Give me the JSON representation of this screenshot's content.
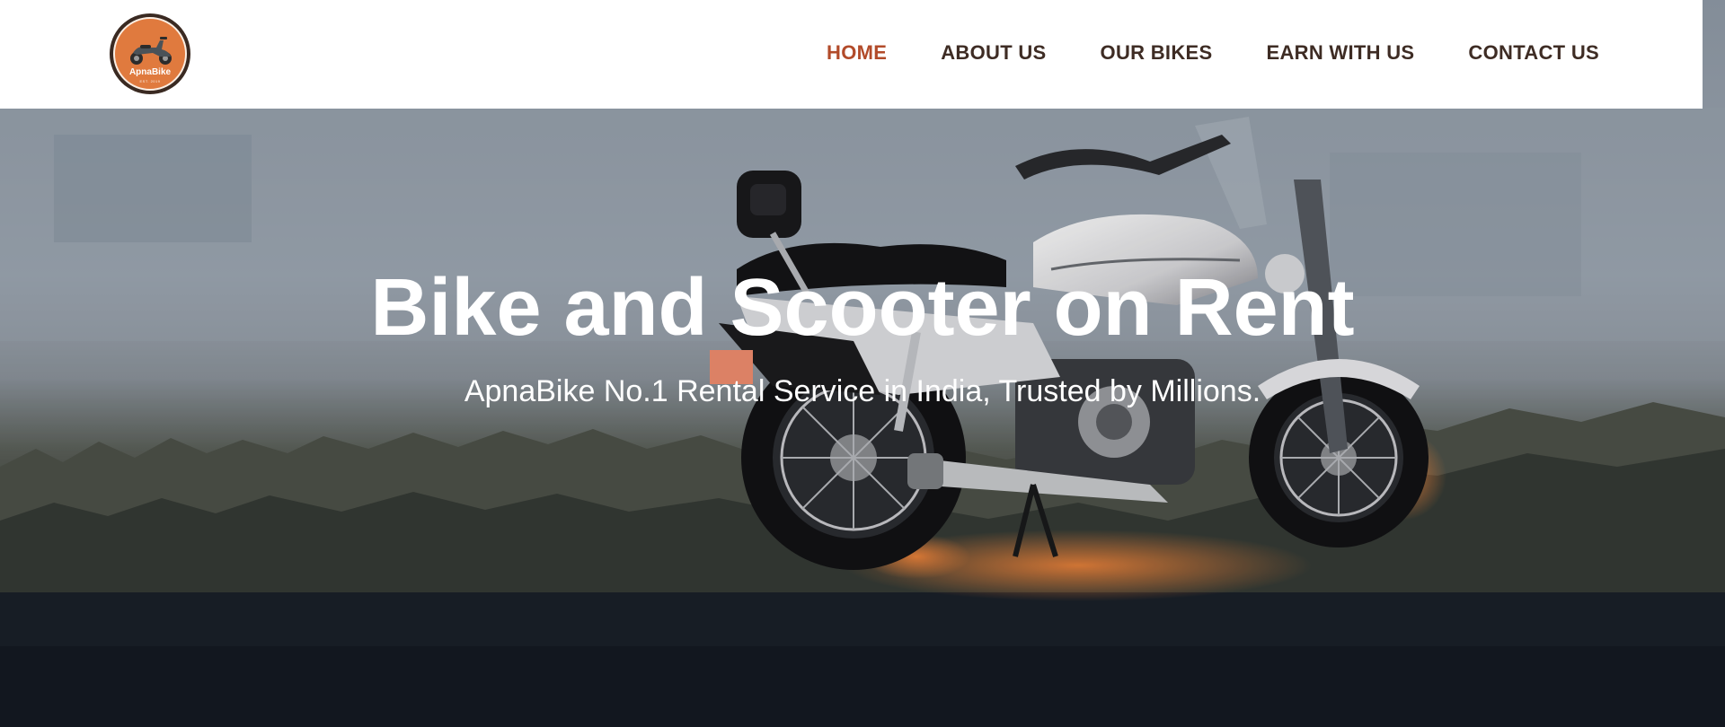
{
  "brand": {
    "logo_text": "ApnaBike",
    "logo_tagline": "RENT A RIDE",
    "logo_year": "EST. 2019",
    "colors": {
      "orange": "#e07a3e",
      "dark_brown": "#3e2c24",
      "active_nav": "#b24b2a"
    }
  },
  "nav": {
    "items": [
      {
        "label": "HOME",
        "active": true
      },
      {
        "label": "ABOUT US",
        "active": false
      },
      {
        "label": "OUR BIKES",
        "active": false
      },
      {
        "label": "EARN WITH US",
        "active": false
      },
      {
        "label": "CONTACT US",
        "active": false
      }
    ]
  },
  "hero": {
    "title": "Bike and Scooter on Rent",
    "subtitle": "ApnaBike No.1 Rental Service in India, Trusted by Millions.",
    "background_icon": "motorcycle-photo"
  }
}
